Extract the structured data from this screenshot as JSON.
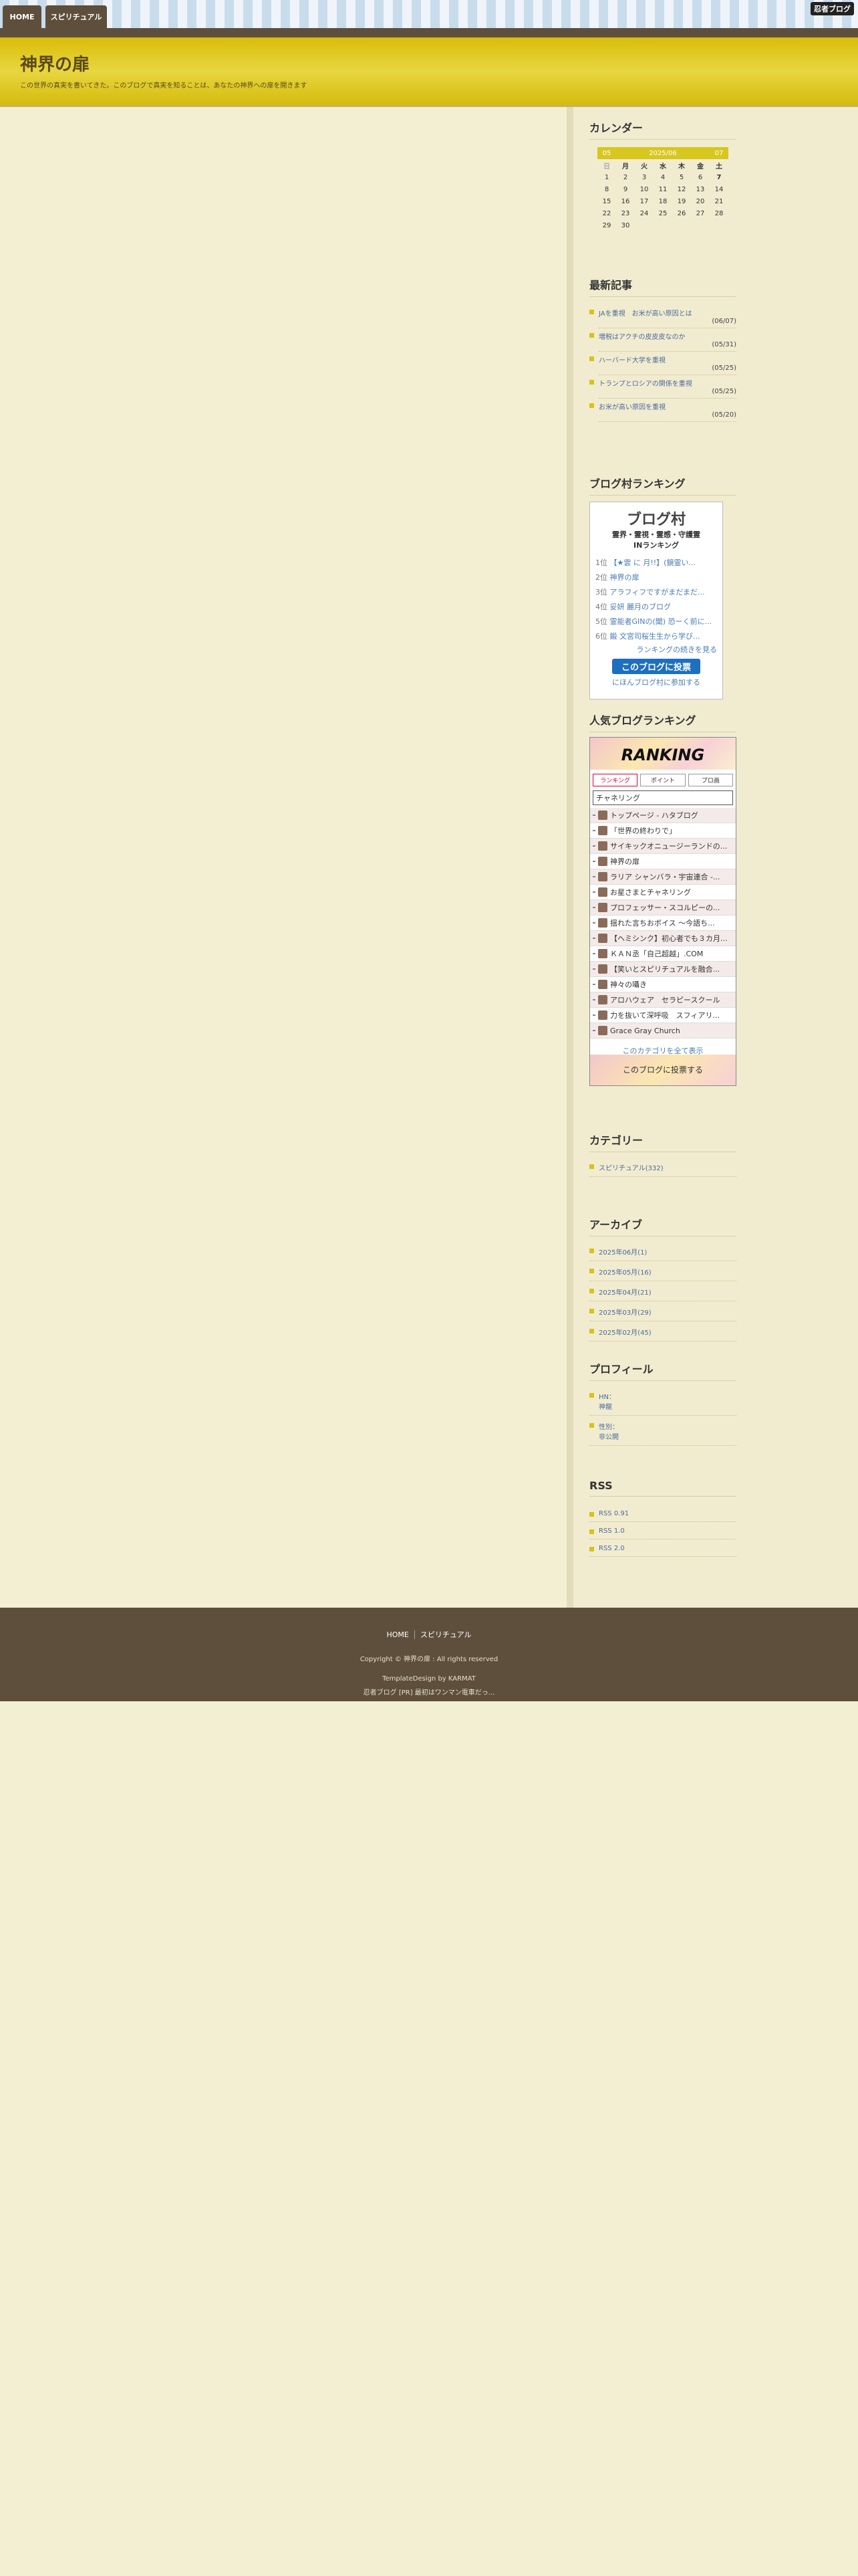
{
  "nav": {
    "home": "HOME",
    "spiritual": "スピリチュアル",
    "brand": "忍者ブログ"
  },
  "site": {
    "title": "神界の扉",
    "description": "この世界の真実を書いてきた。このブログで真実を知ることは、あなたの神界への扉を開きます"
  },
  "calendar": {
    "title": "カレンダー",
    "prev": "05",
    "month": "2025/06",
    "next": "07",
    "weekdays": [
      "日",
      "月",
      "火",
      "水",
      "木",
      "金",
      "土"
    ],
    "rows": [
      [
        "1",
        "2",
        "3",
        "4",
        "5",
        "6",
        "7"
      ],
      [
        "8",
        "9",
        "10",
        "11",
        "12",
        "13",
        "14"
      ],
      [
        "15",
        "16",
        "17",
        "18",
        "19",
        "20",
        "21"
      ],
      [
        "22",
        "23",
        "24",
        "25",
        "26",
        "27",
        "28"
      ],
      [
        "29",
        "30",
        "",
        "",
        "",
        "",
        ""
      ]
    ]
  },
  "recent": {
    "title": "最新記事",
    "items": [
      {
        "label": "JAを重視　お米が高い原因とは",
        "date": "(06/07)"
      },
      {
        "label": "増税はアクチの皮皮皮なのか",
        "date": "(05/31)"
      },
      {
        "label": "ハーバード大学を重視",
        "date": "(05/25)"
      },
      {
        "label": "トランプとロシアの関係を重視",
        "date": "(05/25)"
      },
      {
        "label": "お米が高い原因を重視",
        "date": "(05/20)"
      }
    ]
  },
  "blogmura": {
    "title": "ブログ村ランキング",
    "logo": "ブログ村",
    "sub1": "霊界・霊視・霊感・守護霊",
    "sub2": "INランキング",
    "items": [
      {
        "rank": "1位",
        "text": "【★雲 に 月!!】(鏡霊い..."
      },
      {
        "rank": "2位",
        "text": "神界の扉"
      },
      {
        "rank": "3位",
        "text": "アラフィフですがまだまだ..."
      },
      {
        "rank": "4位",
        "text": "妥妍 麗月のブログ"
      },
      {
        "rank": "5位",
        "text": "霊能者GINの(聞) 恐ーく前に..."
      },
      {
        "rank": "6位",
        "text": "鍛 文宮司桜生生から学び..."
      }
    ],
    "more": "ランキングの続きを見る",
    "vote": "このブログに投票",
    "join": "にほんブログ村に参加する"
  },
  "popular": {
    "title": "人気ブログランキング",
    "logo": "RANKING",
    "tabs": [
      "ランキング",
      "ポイント",
      "プロ画"
    ],
    "select": "チャネリング",
    "items": [
      "トップページ - ハタブログ",
      "「世界の終わりで」",
      "サイキックオニュージーランドの...",
      "神界の扉",
      "ラリア シャンバラ・宇宙連合 -...",
      "お星さまとチャネリング",
      "プロフェッサー・スコルピーの...",
      "揺れた言ちおボイス 〜今語ち...",
      "【ヘミシンク】初心者でも３カ月...",
      "ＫＡＮ丞「自己超越」.COM",
      "【笑いとスピリチュアルを融合...",
      "神々の囁き",
      "アロハウェア　セラピースクール",
      "力を抜いて深呼吸　スフィアリ...",
      "Grace Gray Church"
    ],
    "all": "このカテゴリを全て表示",
    "footer": "このブログに投票する"
  },
  "category": {
    "title": "カテゴリー",
    "items": [
      "スピリチュアル(332)"
    ]
  },
  "archive": {
    "title": "アーカイブ",
    "items": [
      "2025年06月(1)",
      "2025年05月(16)",
      "2025年04月(21)",
      "2025年03月(29)",
      "2025年02月(45)"
    ]
  },
  "profile": {
    "title": "プロフィール",
    "items": [
      {
        "label": "HN：",
        "value": "神龍"
      },
      {
        "label": "性別：",
        "value": "非公開"
      }
    ]
  },
  "rss": {
    "title": "RSS",
    "items": [
      "RSS 0.91",
      "RSS 1.0",
      "RSS 2.0"
    ]
  },
  "footer": {
    "nav": [
      "HOME",
      "スピリチュアル"
    ],
    "copy": "Copyright © 神界の扉 : All rights reserved",
    "design": "TemplateDesign by KARMAT",
    "ad": "忍者ブログ [PR] 最初はワンマン電車だっ..."
  }
}
